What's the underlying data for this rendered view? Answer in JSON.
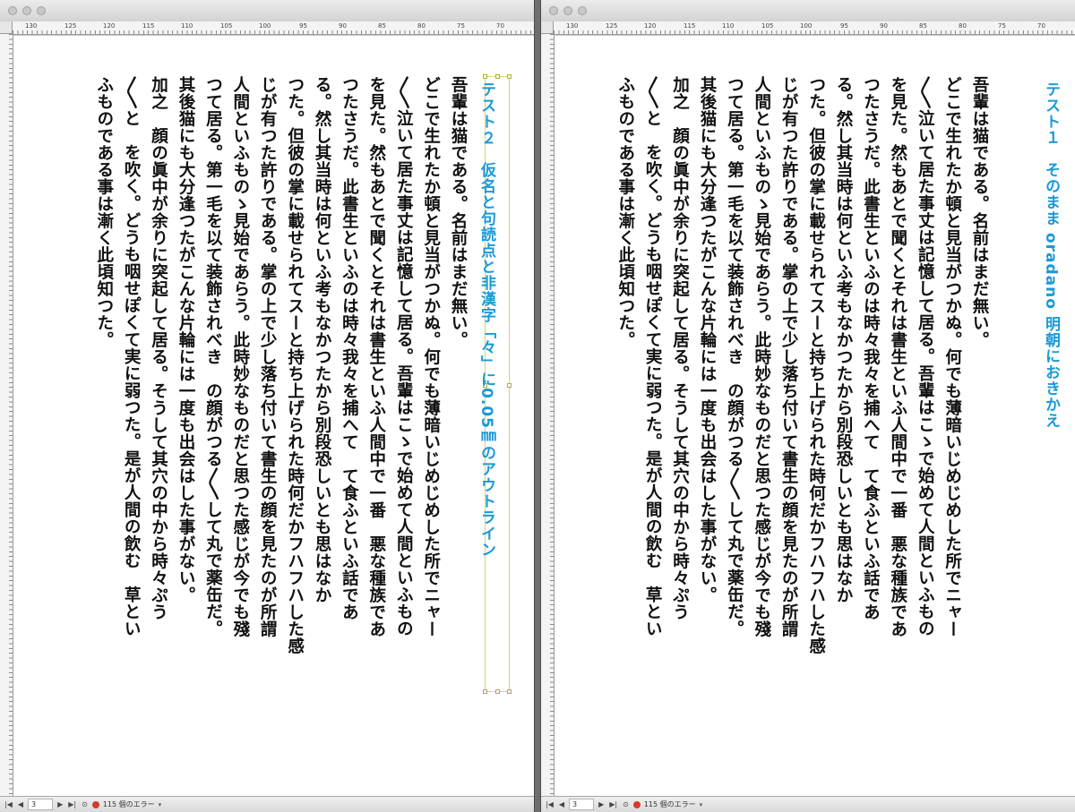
{
  "windows": [
    {
      "id": "left",
      "heading": "テスト２　仮名と句読点と非漢字「々」に0.05㎜のアウトライン",
      "heading_color": "#1a9ad6",
      "ruler_numbers": [
        "130",
        "125",
        "120",
        "115",
        "110",
        "105",
        "100",
        "95",
        "90",
        "85",
        "80",
        "75",
        "70"
      ],
      "body_text": "吾輩は猫である。名前はまだ無い。\nどこで生れたか頓と見当がつかぬ。何でも薄暗いじめじめした所でニャー\n〳〵泣いて居た事丈は記憶して居る。吾輩はこゝで始めて人間といふもの\nを見た。然もあとで聞くとそれは書生といふ人間中で一番　悪な種族であ\nつたさうだ。此書生といふのは時々我々を捕へて　て食ふといふ話であ\nる。然し其当時は何といふ考もなかつたから別段恐しいとも思はなか\nつた。但彼の掌に載せられてスーと持ち上げられた時何だかフハフハした感\nじが有つた許りである。掌の上で少し落ち付いて書生の顔を見たのが所謂\n人間といふものゝ見始であらう。此時妙なものだと思つた感じが今でも殘\nつて居る。第一毛を以て装飾されべき　の顔がつる〳〵して丸で薬缶だ。\n其後猫にも大分逢つたがこんな片輪には一度も出会はした事がない。\n加之　顔の眞中が余りに突起して居る。そうして其穴の中から時々ぷう\n〳〵と　を吹く。どうも咽せぽくて実に弱つた。是が人間の飲む　草とい\nふものである事は漸く此頃知つた。",
      "page_number": "3",
      "errors": "115 個のエラー"
    },
    {
      "id": "right",
      "heading": "テスト１　そのまま oradano 明朝におきかえ",
      "heading_color": "#1a9ad6",
      "ruler_numbers": [
        "130",
        "125",
        "120",
        "115",
        "110",
        "105",
        "100",
        "95",
        "90",
        "85",
        "80",
        "75",
        "70"
      ],
      "body_text": "吾輩は猫である。名前はまだ無い。\nどこで生れたか頓と見当がつかぬ。何でも薄暗いじめじめした所でニャー\n〳〵泣いて居た事丈は記憶して居る。吾輩はこゝで始めて人間といふもの\nを見た。然もあとで聞くとそれは書生といふ人間中で一番　悪な種族であ\nつたさうだ。此書生といふのは時々我々を捕へて　て食ふといふ話であ\nる。然し其当時は何といふ考もなかつたから別段恐しいとも思はなか\nつた。但彼の掌に載せられてスーと持ち上げられた時何だかフハフハした感\nじが有つた許りである。掌の上で少し落ち付いて書生の顔を見たのが所謂\n人間といふものゝ見始であらう。此時妙なものだと思つた感じが今でも殘\nつて居る。第一毛を以て装飾されべき　の顔がつる〳〵して丸で薬缶だ。\n其後猫にも大分逢つたがこんな片輪には一度も出会はした事がない。\n加之　顔の眞中が余りに突起して居る。そうして其穴の中から時々ぷう\n〳〵と　を吹く。どうも咽せぽくて実に弱つた。是が人間の飲む　草とい\nふものである事は漸く此頃知つた。",
      "page_number": "3",
      "errors": "115 個のエラー"
    }
  ]
}
